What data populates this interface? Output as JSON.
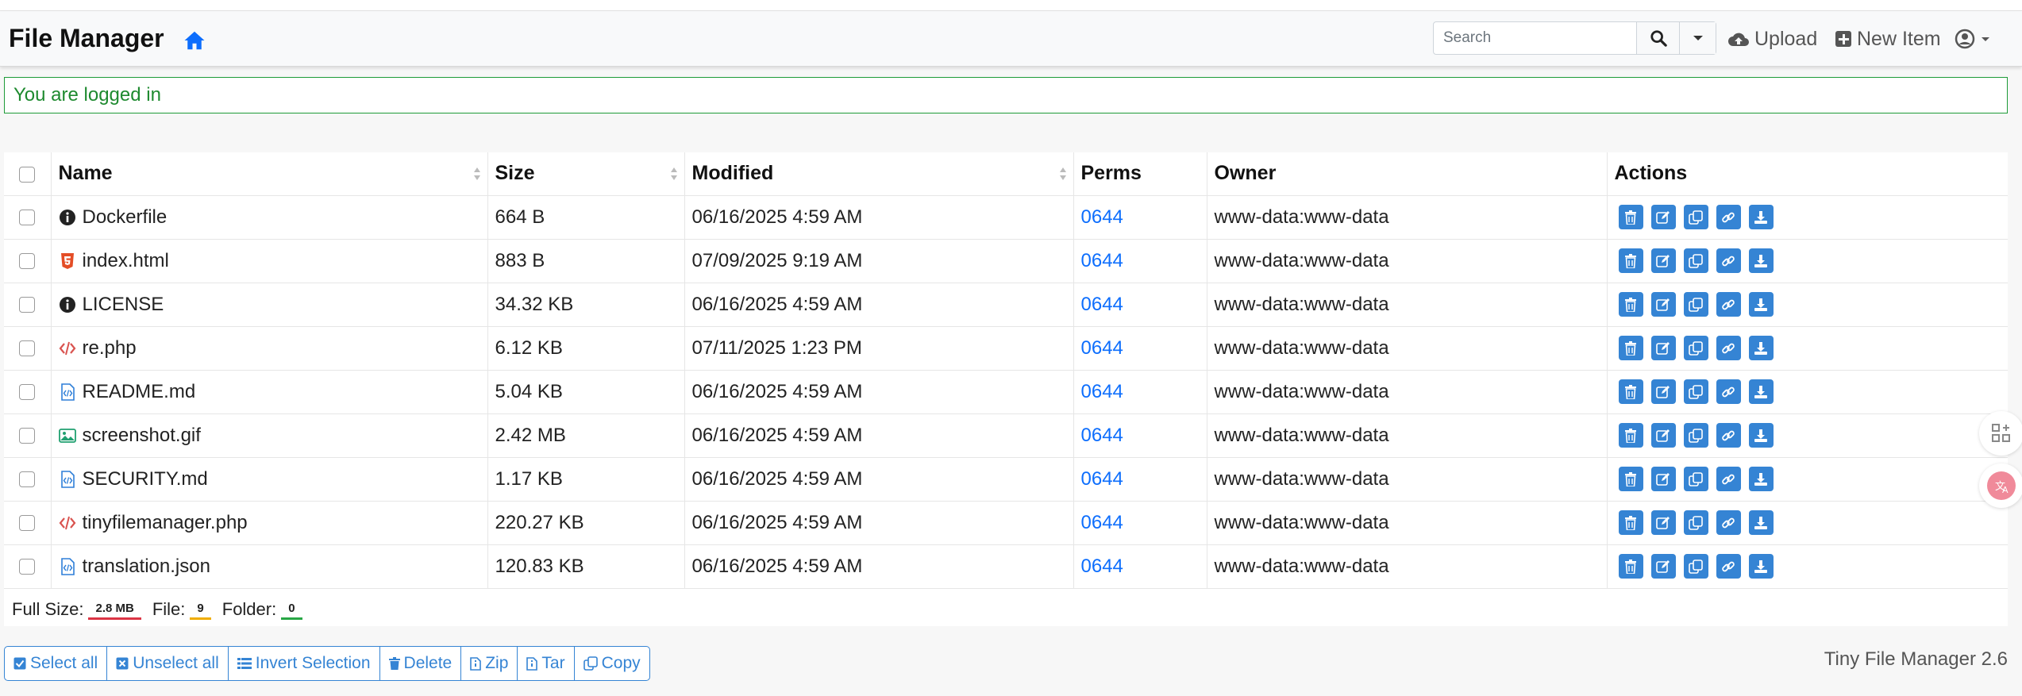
{
  "header": {
    "brand": "File Manager",
    "search_placeholder": "Search",
    "upload_label": "Upload",
    "new_item_label": "New Item"
  },
  "alert": {
    "text": "You are logged in"
  },
  "table": {
    "columns": {
      "name": "Name",
      "size": "Size",
      "modified": "Modified",
      "perms": "Perms",
      "owner": "Owner",
      "actions": "Actions"
    },
    "rows": [
      {
        "name": "Dockerfile",
        "icon": "info-circle-icon",
        "size": "664 B",
        "modified": "06/16/2025 4:59 AM",
        "perms": "0644",
        "owner": "www-data:www-data"
      },
      {
        "name": "index.html",
        "icon": "html5-icon",
        "size": "883 B",
        "modified": "07/09/2025 9:19 AM",
        "perms": "0644",
        "owner": "www-data:www-data"
      },
      {
        "name": "LICENSE",
        "icon": "info-circle-icon",
        "size": "34.32 KB",
        "modified": "06/16/2025 4:59 AM",
        "perms": "0644",
        "owner": "www-data:www-data"
      },
      {
        "name": "re.php",
        "icon": "code-icon",
        "size": "6.12 KB",
        "modified": "07/11/2025 1:23 PM",
        "perms": "0644",
        "owner": "www-data:www-data"
      },
      {
        "name": "README.md",
        "icon": "code-file-icon",
        "size": "5.04 KB",
        "modified": "06/16/2025 4:59 AM",
        "perms": "0644",
        "owner": "www-data:www-data"
      },
      {
        "name": "screenshot.gif",
        "icon": "image-icon",
        "size": "2.42 MB",
        "modified": "06/16/2025 4:59 AM",
        "perms": "0644",
        "owner": "www-data:www-data"
      },
      {
        "name": "SECURITY.md",
        "icon": "code-file-icon",
        "size": "1.17 KB",
        "modified": "06/16/2025 4:59 AM",
        "perms": "0644",
        "owner": "www-data:www-data"
      },
      {
        "name": "tinyfilemanager.php",
        "icon": "code-icon",
        "size": "220.27 KB",
        "modified": "06/16/2025 4:59 AM",
        "perms": "0644",
        "owner": "www-data:www-data"
      },
      {
        "name": "translation.json",
        "icon": "code-file-icon",
        "size": "120.83 KB",
        "modified": "06/16/2025 4:59 AM",
        "perms": "0644",
        "owner": "www-data:www-data"
      }
    ],
    "summary": {
      "full_size_label": "Full Size:",
      "full_size_value": "2.8 MB",
      "file_label": "File:",
      "file_value": "9",
      "folder_label": "Folder:",
      "folder_value": "0"
    }
  },
  "bulk_actions": {
    "select_all": "Select all",
    "unselect_all": "Unselect all",
    "invert_selection": "Invert Selection",
    "delete": "Delete",
    "zip": "Zip",
    "tar": "Tar",
    "copy": "Copy"
  },
  "footer": {
    "version": "Tiny File Manager 2.6"
  },
  "colors": {
    "accent": "#3584d4",
    "link": "#0d6efd",
    "success": "#1e9b37",
    "html_icon": "#e44d26",
    "code_icon": "#d9534f",
    "image_icon": "#20a070"
  }
}
